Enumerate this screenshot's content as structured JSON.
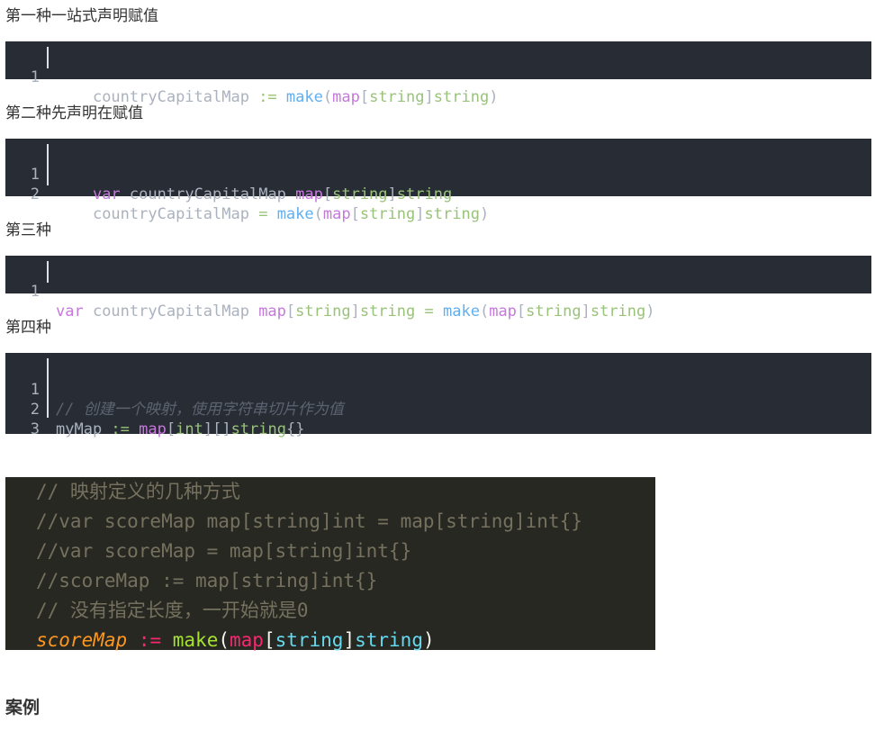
{
  "sections": [
    {
      "label": "第一种一站式声明赋值"
    },
    {
      "label": "第二种先声明在赋值"
    },
    {
      "label": "第三种"
    },
    {
      "label": "第四种"
    }
  ],
  "block1": {
    "line_numbers": [
      "1"
    ],
    "l1": {
      "indent": "    ",
      "a": "countryCapitalMap ",
      "op": ":=",
      "sp": " ",
      "fn": "make",
      "p1": "(",
      "kw": "map",
      "b1": "[",
      "t1": "string",
      "b2": "]",
      "t2": "string",
      "p2": ")"
    }
  },
  "block2": {
    "line_numbers": [
      "1",
      "2"
    ],
    "l1": {
      "indent": "    ",
      "kw1": "var",
      "a": " countryCapitalMap ",
      "kw2": "map",
      "b1": "[",
      "t1": "string",
      "b2": "]",
      "t2": "string"
    },
    "l2": {
      "indent": "    ",
      "a": "countryCapitalMap ",
      "op": "=",
      "sp": " ",
      "fn": "make",
      "p1": "(",
      "kw": "map",
      "b1": "[",
      "t1": "string",
      "b2": "]",
      "t2": "string",
      "p2": ")"
    }
  },
  "block3": {
    "line_numbers": [
      "1"
    ],
    "l1": {
      "kw1": "var",
      "a": " countryCapitalMap ",
      "kw2": "map",
      "b1": "[",
      "t1": "string",
      "b2": "]",
      "t2": "string",
      "sp1": " ",
      "op": "=",
      "sp2": " ",
      "fn": "make",
      "p1": "(",
      "kw3": "map",
      "b3": "[",
      "t3": "string",
      "b4": "]",
      "t4": "string",
      "p2": ")"
    }
  },
  "block4": {
    "line_numbers": [
      "1",
      "2",
      "3"
    ],
    "l1": {
      "comment": "// 创建一个映射，使用字符串切片作为值"
    },
    "l2": {
      "a": "myMap ",
      "op": ":=",
      "sp": " ",
      "kw": "map",
      "b1": "[",
      "t1": "int",
      "b2": "][]",
      "t2": "string",
      "b3": "{}"
    }
  },
  "block5": {
    "c1": "// 映射定义的几种方式",
    "c2": "//var scoreMap map[string]int = map[string]int{}",
    "c3": "//var scoreMap = map[string]int{}",
    "c4": "//scoreMap := map[string]int{}",
    "c5": "// 没有指定长度，一开始就是0",
    "l6": {
      "var": "scoreMap",
      "sp1": " ",
      "op": ":=",
      "sp2": " ",
      "fn": "make",
      "p1": "(",
      "kw": "map",
      "b1": "[",
      "t1": "string",
      "b2": "]",
      "t2": "string",
      "p2": ")"
    }
  },
  "heading": "案例"
}
